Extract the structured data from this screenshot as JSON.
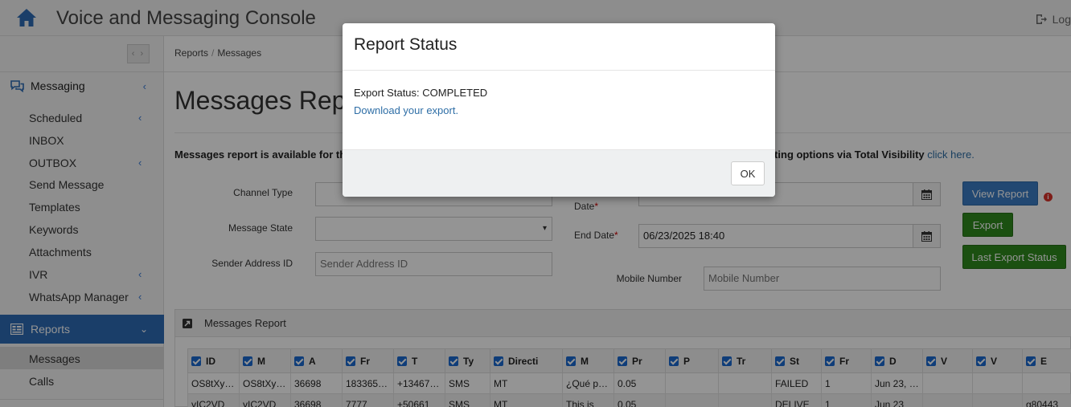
{
  "header": {
    "title": "Voice and Messaging Console",
    "logout_label": "Log"
  },
  "sidebar": {
    "collapse_label": "‹ ›",
    "messaging": {
      "label": "Messaging",
      "items": [
        {
          "label": "Scheduled",
          "has_submenu": true
        },
        {
          "label": "INBOX",
          "has_submenu": false
        },
        {
          "label": "OUTBOX",
          "has_submenu": true
        },
        {
          "label": "Send Message",
          "has_submenu": false
        },
        {
          "label": "Templates",
          "has_submenu": false
        },
        {
          "label": "Keywords",
          "has_submenu": false
        },
        {
          "label": "Attachments",
          "has_submenu": false
        },
        {
          "label": "IVR",
          "has_submenu": true
        },
        {
          "label": "WhatsApp Manager",
          "has_submenu": true
        }
      ]
    },
    "reports": {
      "label": "Reports",
      "items": [
        {
          "label": "Messages",
          "active": true
        },
        {
          "label": "Calls",
          "active": false
        }
      ]
    }
  },
  "breadcrumb": [
    "Reports",
    "Messages"
  ],
  "page": {
    "title": "Messages Repo",
    "notice_left": "Messages report is available for the",
    "notice_right": "rting options via Total Visibility",
    "notice_link": "click here."
  },
  "filters": {
    "channel_type_label": "Channel Type",
    "message_state_label": "Message State",
    "sender_label": "Sender Address ID",
    "sender_placeholder": "Sender Address ID",
    "start_date_label": "Date",
    "start_date_required": "*",
    "end_date_label": "End Date",
    "end_date_required": "*",
    "end_date_value": "06/23/2025 18:40",
    "mobile_label": "Mobile Number",
    "mobile_placeholder": "Mobile Number"
  },
  "buttons": {
    "view_report": "View Report",
    "export": "Export",
    "last_export_status": "Last Export Status"
  },
  "report_panel": {
    "title": "Messages Report",
    "columns": [
      "ID",
      "M",
      "A",
      "Fr",
      "T",
      "Ty",
      "Directi",
      "M",
      "Pr",
      "P",
      "Tr",
      "St",
      "Fr",
      "D",
      "V",
      "V",
      "E"
    ],
    "rows": [
      [
        "OS8tXy…",
        "OS8tXy…",
        "36698",
        "183365…",
        "+13467…",
        "SMS",
        "MT",
        "¿Qué p…",
        "0.05",
        "",
        "",
        "FAILED",
        "1",
        "Jun 23, …",
        "",
        "",
        ""
      ],
      [
        "yIC2VD",
        "yIC2VD",
        "36698",
        "7777",
        "+50661",
        "SMS",
        "MT",
        "This is",
        "0.05",
        "",
        "",
        "DELIVE",
        "1",
        "Jun 23",
        "",
        "",
        "g80443"
      ]
    ]
  },
  "modal": {
    "title": "Report Status",
    "status_text": "Export Status: COMPLETED",
    "link_text": "Download your export.",
    "ok_label": "OK"
  }
}
